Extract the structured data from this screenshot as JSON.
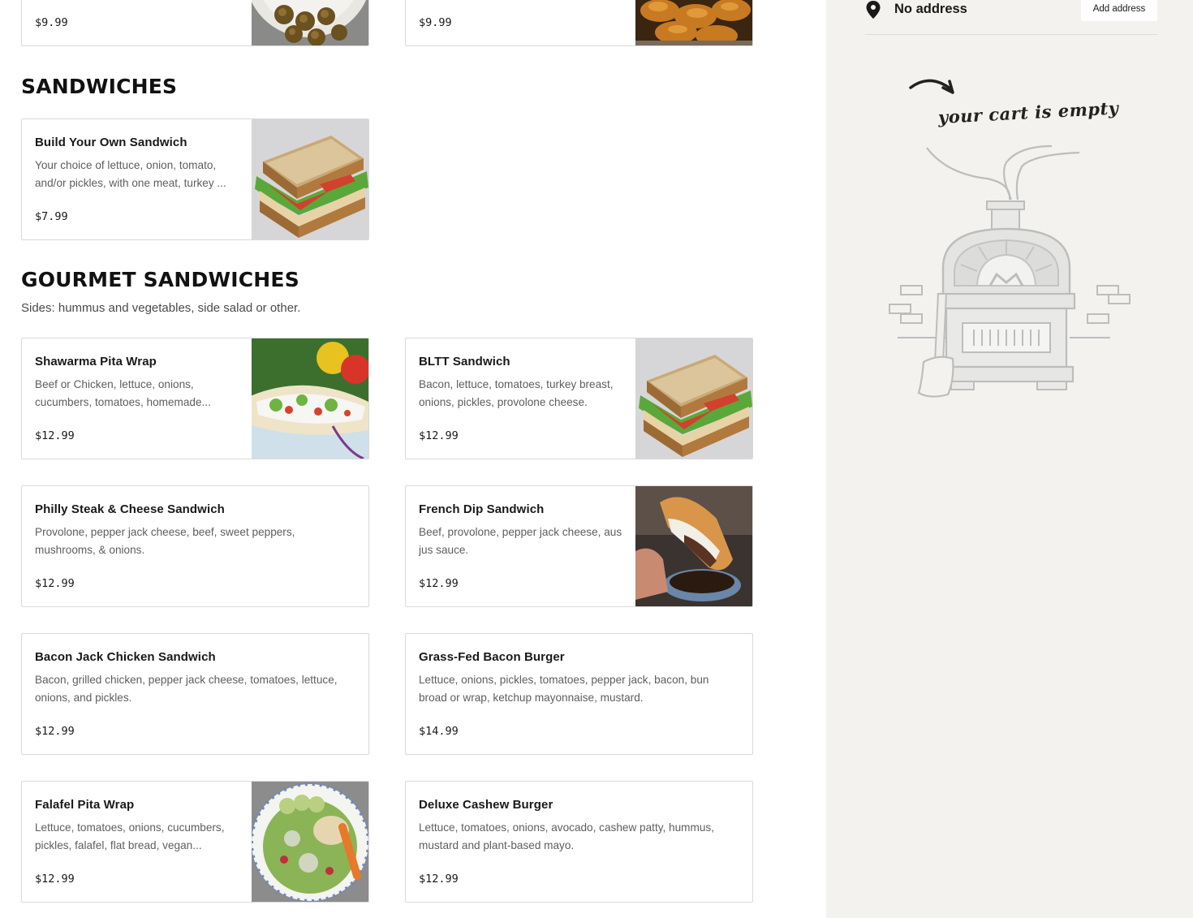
{
  "sections": {
    "sandwiches": {
      "title": "SANDWICHES"
    },
    "gourmet": {
      "title": "GOURMET SANDWICHES",
      "subtitle": "Sides: hummus and vegetables, side salad or other."
    }
  },
  "top_items": [
    {
      "price": "$9.99",
      "image": "fried-croquettes-photo"
    },
    {
      "price": "$9.99",
      "image": "chips-photo"
    }
  ],
  "sandwiches": [
    {
      "name": "Build Your Own Sandwich",
      "description": "Your choice of lettuce, onion, tomato, and/or pickles, with one meat, turkey ...",
      "price": "$7.99",
      "image": "sandwich-photo"
    }
  ],
  "gourmet": [
    {
      "name": "Shawarma Pita Wrap",
      "description": "Beef or Chicken, lettuce, onions, cucumbers, tomatoes, homemade...",
      "price": "$12.99",
      "image": "pita-wrap-photo"
    },
    {
      "name": "BLTT Sandwich",
      "description": "Bacon, lettuce, tomatoes, turkey breast, onions, pickles, provolone cheese.",
      "price": "$12.99",
      "image": "sandwich-photo"
    },
    {
      "name": "Philly Steak & Cheese Sandwich",
      "description": "Provolone, pepper jack cheese, beef, sweet peppers, mushrooms, & onions.",
      "price": "$12.99"
    },
    {
      "name": "French Dip Sandwich",
      "description": "Beef, provolone, pepper jack cheese, aus jus sauce.",
      "price": "$12.99",
      "image": "french-dip-photo"
    },
    {
      "name": "Bacon Jack Chicken Sandwich",
      "description": "Bacon, grilled chicken, pepper jack cheese, tomatoes, lettuce, onions, and pickles.",
      "price": "$12.99"
    },
    {
      "name": "Grass-Fed Bacon Burger",
      "description": "Lettuce, onions, pickles, tomatoes, pepper jack, bacon, bun broad or wrap, ketchup mayonnaise, mustard.",
      "price": "$14.99"
    },
    {
      "name": "Falafel Pita Wrap",
      "description": "Lettuce, tomatoes, onions, cucumbers, pickles, falafel, flat bread, vegan...",
      "price": "$12.99",
      "image": "falafel-plate-photo"
    },
    {
      "name": "Deluxe Cashew Burger",
      "description": "Lettuce, tomatoes, onions, avocado, cashew patty, hummus, mustard and plant-based mayo.",
      "price": "$12.99"
    }
  ],
  "cart": {
    "address_icon": "location-pin-icon",
    "address_text": "No address",
    "add_address_label": "Add address",
    "empty_message": "your cart is empty",
    "illustration": "pizza-oven-illustration"
  },
  "colors": {
    "cart_background": "#f3f2ef",
    "card_border": "#d9d9d9",
    "description_text": "#5e5e5e"
  }
}
